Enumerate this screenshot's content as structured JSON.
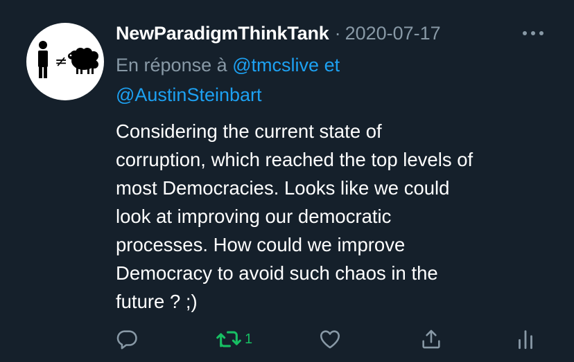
{
  "tweet": {
    "author": "NewParadigmThinkTank",
    "separator": "·",
    "date": "2020-07-17",
    "reply_prefix": "En réponse à",
    "reply_mention_1": "@tmcslive",
    "reply_conjunction": "et",
    "reply_mention_2": "@AustinSteinbart",
    "text": "Considering the current state of\ncorruption, which reached the top levels of\nmost Democracies. Looks like we could\nlook at improving our democratic\nprocesses. How could we improve\nDemocracy to avoid such chaos in the\nfuture ? ;)",
    "avatar_symbol": "≠"
  },
  "actions": {
    "retweet_count": "1"
  },
  "icons": {
    "more": "more-dots-icon",
    "reply": "reply-bubble-icon",
    "retweet": "retweet-icon",
    "like": "heart-icon",
    "share": "share-upload-icon",
    "analytics": "analytics-bars-icon"
  },
  "colors": {
    "background": "#15202b",
    "text_primary": "#ffffff",
    "text_secondary": "#8899a6",
    "link": "#1da1f2",
    "retweet_active": "#17bf63"
  }
}
